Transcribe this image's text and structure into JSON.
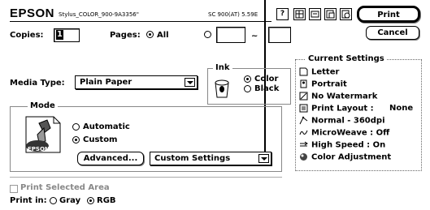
{
  "header": {
    "brand": "EPSON",
    "printer_name": "Stylus_COLOR_900-9A3356\"",
    "model": "SC 900(AT) 5.59E"
  },
  "buttons": {
    "print": "Print",
    "cancel": "Cancel",
    "advanced": "Advanced...",
    "help": "?"
  },
  "copies": {
    "label": "Copies:",
    "value": "1"
  },
  "pages": {
    "label": "Pages:",
    "all_label": "All",
    "range_separator": "~",
    "from_value": "",
    "to_value": ""
  },
  "media": {
    "label": "Media Type:",
    "value": "Plain Paper"
  },
  "ink": {
    "title": "Ink",
    "options": [
      "Color",
      "Black"
    ],
    "selected": "Color"
  },
  "mode": {
    "title": "Mode",
    "options": [
      "Automatic",
      "Custom"
    ],
    "selected": "Custom",
    "custom_setting_value": "Custom Settings",
    "logo_text": "EPSON"
  },
  "current_settings": {
    "title": "Current Settings",
    "items": [
      {
        "icon": "paper-icon",
        "text": "Letter"
      },
      {
        "icon": "portrait-icon",
        "text": "Portrait"
      },
      {
        "icon": "watermark-icon",
        "text": "No Watermark"
      },
      {
        "icon": "layout-icon",
        "text": "Print Layout :",
        "value": "None"
      },
      {
        "icon": "quality-icon",
        "text": "Normal - 360dpi"
      },
      {
        "icon": "microweave-icon",
        "text": "MicroWeave : Off"
      },
      {
        "icon": "speed-icon",
        "text": "High Speed : On"
      },
      {
        "icon": "color-adjust-icon",
        "text": "Color Adjustment"
      }
    ]
  },
  "footer": {
    "print_selected_area": "Print Selected Area",
    "print_in_label": "Print in:",
    "options": [
      "Gray",
      "RGB"
    ],
    "selected": "RGB"
  }
}
